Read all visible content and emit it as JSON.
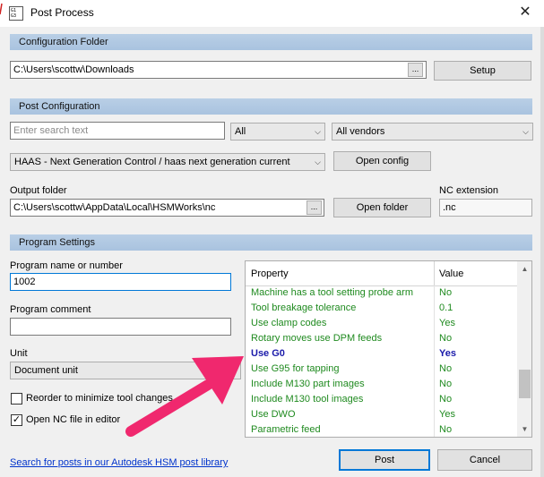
{
  "window": {
    "title": "Post Process",
    "icon_text": "G1\nG3",
    "close_glyph": "✕"
  },
  "config_folder": {
    "header": "Configuration Folder",
    "path": "C:\\Users\\scottw\\Downloads",
    "browse_label": "...",
    "setup_label": "Setup"
  },
  "post_config": {
    "header": "Post Configuration",
    "search_placeholder": "Enter search text",
    "filter_value": "All",
    "vendor_value": "All vendors",
    "post_value": "HAAS - Next Generation Control / haas next generation current",
    "open_config_label": "Open config",
    "output_folder_label": "Output folder",
    "output_folder_path": "C:\\Users\\scottw\\AppData\\Local\\HSMWorks\\nc",
    "output_browse_label": "...",
    "open_folder_label": "Open folder",
    "nc_extension_label": "NC extension",
    "nc_extension_value": ".nc"
  },
  "program_settings": {
    "header": "Program Settings",
    "program_name_label": "Program name or number",
    "program_name_value": "1002",
    "program_comment_label": "Program comment",
    "program_comment_value": "",
    "unit_label": "Unit",
    "unit_value": "Document unit",
    "reorder_label": "Reorder to minimize tool changes",
    "reorder_checked": false,
    "open_nc_label": "Open NC file in editor",
    "open_nc_checked": true,
    "check_glyph": "✓"
  },
  "properties": {
    "col_property": "Property",
    "col_value": "Value",
    "rows": [
      {
        "property": "Machine has a tool setting probe arm",
        "value": "No"
      },
      {
        "property": "Tool breakage tolerance",
        "value": "0.1"
      },
      {
        "property": "Use clamp codes",
        "value": "Yes"
      },
      {
        "property": "Rotary moves use DPM feeds",
        "value": "No"
      },
      {
        "property": "Use G0",
        "value": "Yes"
      },
      {
        "property": "Use G95 for tapping",
        "value": "No"
      },
      {
        "property": "Include M130 part images",
        "value": "No"
      },
      {
        "property": "Include M130 tool images",
        "value": "No"
      },
      {
        "property": "Use DWO",
        "value": "Yes"
      },
      {
        "property": "Parametric feed",
        "value": "No"
      }
    ],
    "scroll_up": "▲",
    "scroll_down": "▼"
  },
  "footer": {
    "library_link": "Search for posts in our Autodesk HSM post library",
    "post_label": "Post",
    "cancel_label": "Cancel"
  },
  "colors": {
    "arrow": "#f0286e",
    "property_text": "#1f8a1f",
    "highlight_text": "#1a1aaa"
  },
  "dropdown_arrow": "⌵"
}
